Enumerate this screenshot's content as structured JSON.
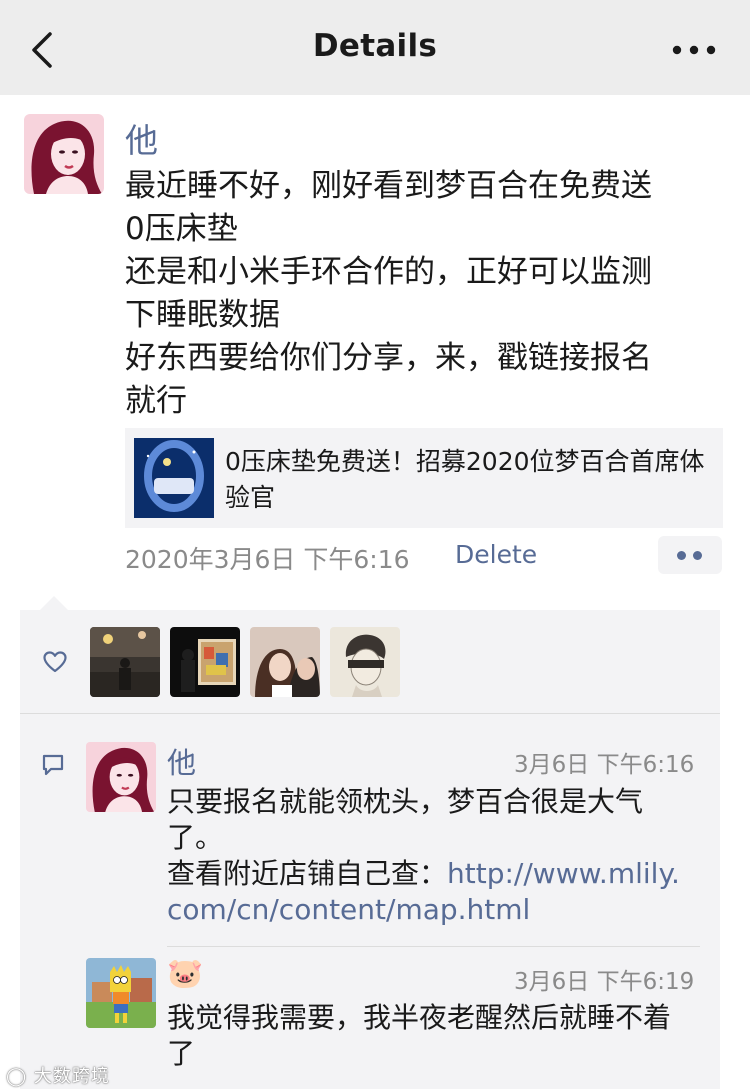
{
  "header": {
    "title": "Details"
  },
  "post": {
    "author": "他",
    "text": "最近睡不好，刚好看到梦百合在免费送\n0压床垫\n还是和小米手环合作的，正好可以监测\n下睡眠数据\n好东西要给你们分享，来，戳链接报名\n就行",
    "link": {
      "title": "0压床垫免费送！招募2020位梦百合首席体验官"
    },
    "time": "2020年3月6日 下午6:16",
    "delete_label": "Delete"
  },
  "comments": [
    {
      "author": "他",
      "time": "3月6日 下午6:16",
      "text_line1": "只要报名就能领枕头，梦百合很是大气了。",
      "text_line2_prefix": "查看附近店铺自己查：",
      "url": "http://www.mlily.com/cn/content/map.html"
    },
    {
      "author": "🐷",
      "time": "3月6日 下午6:19",
      "text": "我觉得我需要，我半夜老醒然后就睡不着了"
    }
  ],
  "watermark": "大数跨境",
  "colors": {
    "link_blue": "#576b95",
    "panel_gray": "#f3f3f5",
    "header_gray": "#ededed"
  }
}
